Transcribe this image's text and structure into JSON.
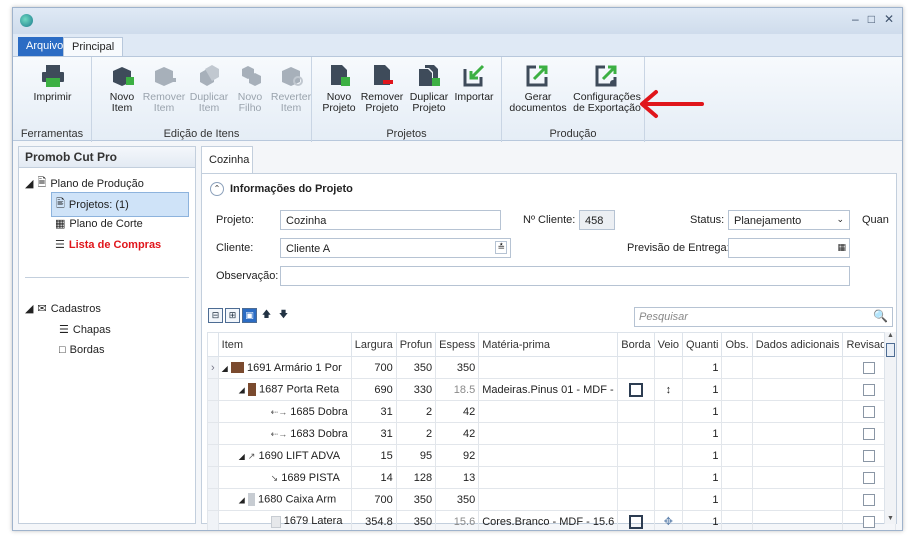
{
  "ribbon": {
    "tabs": [
      "Arquivo",
      "Principal"
    ],
    "groups": [
      {
        "label": "Ferramentas",
        "buttons": [
          {
            "label": "Imprimir",
            "enabled": true
          }
        ]
      },
      {
        "label": "Edição de Itens",
        "buttons": [
          {
            "label": "Novo\nItem",
            "enabled": true
          },
          {
            "label": "Remover\nItem",
            "enabled": false
          },
          {
            "label": "Duplicar\nItem",
            "enabled": false
          },
          {
            "label": "Novo\nFilho",
            "enabled": false
          },
          {
            "label": "Reverter\nItem",
            "enabled": false
          }
        ]
      },
      {
        "label": "Projetos",
        "buttons": [
          {
            "label": "Novo\nProjeto",
            "enabled": true
          },
          {
            "label": "Remover\nProjeto",
            "enabled": true
          },
          {
            "label": "Duplicar\nProjeto",
            "enabled": true
          },
          {
            "label": "Importar",
            "enabled": true
          }
        ]
      },
      {
        "label": "Produção",
        "buttons": [
          {
            "label": "Gerar\ndocumentos",
            "enabled": true
          },
          {
            "label": "Configurações\nde Exportação",
            "enabled": true
          }
        ]
      }
    ]
  },
  "sidebar": {
    "title": "Promob Cut Pro",
    "tree": [
      {
        "label": "Plano de Produção"
      },
      {
        "label": "Projetos: (1)"
      },
      {
        "label": "Plano de Corte"
      },
      {
        "label": "Lista de Compras"
      },
      {
        "label": "Cadastros"
      },
      {
        "label": "Chapas"
      },
      {
        "label": "Bordas"
      }
    ]
  },
  "document_tab": "Cozinha",
  "project_info": {
    "section_title": "Informações do Projeto",
    "projeto_label": "Projeto:",
    "projeto_value": "Cozinha",
    "num_cliente_label": "Nº Cliente:",
    "num_cliente_value": "458",
    "status_label": "Status:",
    "status_value": "Planejamento",
    "quant_label": "Quan",
    "cliente_label": "Cliente:",
    "cliente_value": "Cliente A",
    "previsao_label": "Previsão de Entrega:",
    "previsao_value": "",
    "observacao_label": "Observação:",
    "observacao_value": ""
  },
  "search": {
    "placeholder": "Pesquisar"
  },
  "grid": {
    "columns": [
      "Item",
      "Largura",
      "Profun",
      "Espess",
      "Matéria-prima",
      "Borda",
      "Veio",
      "Quanti",
      "Obs.",
      "Dados adicionais",
      "Revisado"
    ],
    "rows": [
      {
        "item": "1691 Armário 1 Por",
        "largura": "700",
        "profun": "350",
        "espess": "350",
        "materia": "",
        "borda": false,
        "veio": false,
        "quant": "1"
      },
      {
        "item": "1687 Porta Reta",
        "largura": "690",
        "profun": "330",
        "espess": "18.5",
        "materia": "Madeiras.Pinus 01 - MDF -",
        "borda": true,
        "veio": true,
        "quant": "1"
      },
      {
        "item": "1685 Dobra",
        "largura": "31",
        "profun": "2",
        "espess": "42",
        "materia": "",
        "borda": false,
        "veio": false,
        "quant": "1"
      },
      {
        "item": "1683 Dobra",
        "largura": "31",
        "profun": "2",
        "espess": "42",
        "materia": "",
        "borda": false,
        "veio": false,
        "quant": "1"
      },
      {
        "item": "1690 LIFT ADVA",
        "largura": "15",
        "profun": "95",
        "espess": "92",
        "materia": "",
        "borda": false,
        "veio": false,
        "quant": "1"
      },
      {
        "item": "1689 PISTA",
        "largura": "14",
        "profun": "128",
        "espess": "13",
        "materia": "",
        "borda": false,
        "veio": false,
        "quant": "1"
      },
      {
        "item": "1680 Caixa Arm",
        "largura": "700",
        "profun": "350",
        "espess": "350",
        "materia": "",
        "borda": false,
        "veio": false,
        "quant": "1"
      },
      {
        "item": "1679 Latera",
        "largura": "354.8",
        "profun": "350",
        "espess": "15.6",
        "materia": "Cores.Branco - MDF - 15.6",
        "borda": true,
        "veio": true,
        "quant": "1"
      }
    ]
  },
  "colors": {
    "accent": "#2b6cc4",
    "arrow": "#e0151b",
    "icon_green": "#3cb043",
    "icon_dark": "#3e4b5a"
  }
}
